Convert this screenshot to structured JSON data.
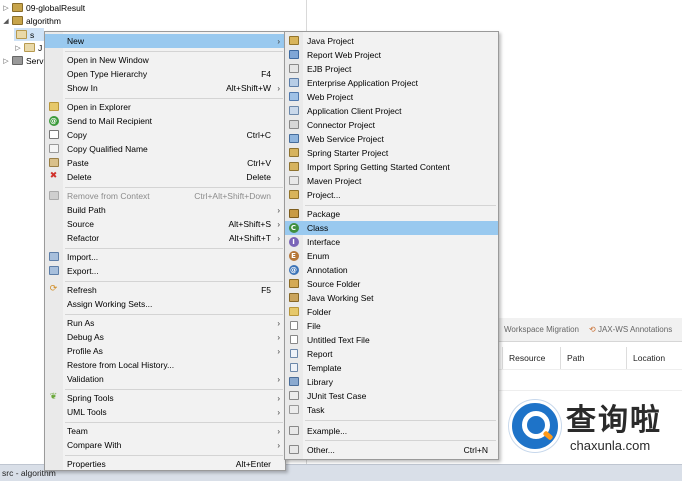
{
  "tree": {
    "items": [
      {
        "label": "09-globalResult"
      },
      {
        "label": "algorithm"
      },
      {
        "label": "s"
      },
      {
        "label": "J"
      },
      {
        "label": "Serv"
      }
    ]
  },
  "views": {
    "tabs": [
      "Workspace Migration",
      "JAX-WS Annotations"
    ],
    "columns": [
      "Resource",
      "Path",
      "Location"
    ]
  },
  "status_bar": {
    "text": "src - algorithm"
  },
  "context_menu": {
    "items": [
      {
        "label": "New",
        "accel": ""
      },
      {
        "label": "Open in New Window",
        "accel": ""
      },
      {
        "label": "Open Type Hierarchy",
        "accel": "F4"
      },
      {
        "label": "Show In",
        "accel": "Alt+Shift+W"
      },
      {
        "label": "Open in Explorer",
        "accel": ""
      },
      {
        "label": "Send to Mail Recipient",
        "accel": ""
      },
      {
        "label": "Copy",
        "accel": "Ctrl+C"
      },
      {
        "label": "Copy Qualified Name",
        "accel": ""
      },
      {
        "label": "Paste",
        "accel": "Ctrl+V"
      },
      {
        "label": "Delete",
        "accel": "Delete"
      },
      {
        "label": "Remove from Context",
        "accel": "Ctrl+Alt+Shift+Down"
      },
      {
        "label": "Build Path",
        "accel": ""
      },
      {
        "label": "Source",
        "accel": "Alt+Shift+S"
      },
      {
        "label": "Refactor",
        "accel": "Alt+Shift+T"
      },
      {
        "label": "Import...",
        "accel": ""
      },
      {
        "label": "Export...",
        "accel": ""
      },
      {
        "label": "Refresh",
        "accel": "F5"
      },
      {
        "label": "Assign Working Sets...",
        "accel": ""
      },
      {
        "label": "Run As",
        "accel": ""
      },
      {
        "label": "Debug As",
        "accel": ""
      },
      {
        "label": "Profile As",
        "accel": ""
      },
      {
        "label": "Restore from Local History...",
        "accel": ""
      },
      {
        "label": "Validation",
        "accel": ""
      },
      {
        "label": "Spring Tools",
        "accel": ""
      },
      {
        "label": "UML Tools",
        "accel": ""
      },
      {
        "label": "Team",
        "accel": ""
      },
      {
        "label": "Compare With",
        "accel": ""
      },
      {
        "label": "Properties",
        "accel": "Alt+Enter"
      }
    ]
  },
  "submenu": {
    "items": [
      {
        "label": "Java Project"
      },
      {
        "label": "Report Web Project"
      },
      {
        "label": "EJB Project"
      },
      {
        "label": "Enterprise Application Project"
      },
      {
        "label": "Web Project"
      },
      {
        "label": "Application Client Project"
      },
      {
        "label": "Connector Project"
      },
      {
        "label": "Web Service Project"
      },
      {
        "label": "Spring Starter Project"
      },
      {
        "label": "Import Spring Getting Started Content"
      },
      {
        "label": "Maven Project"
      },
      {
        "label": "Project..."
      },
      {
        "label": "Package"
      },
      {
        "label": "Class"
      },
      {
        "label": "Interface"
      },
      {
        "label": "Enum"
      },
      {
        "label": "Annotation"
      },
      {
        "label": "Source Folder"
      },
      {
        "label": "Java Working Set"
      },
      {
        "label": "Folder"
      },
      {
        "label": "File"
      },
      {
        "label": "Untitled Text File"
      },
      {
        "label": "Report"
      },
      {
        "label": "Template"
      },
      {
        "label": "Library"
      },
      {
        "label": "JUnit Test Case"
      },
      {
        "label": "Task"
      },
      {
        "label": "Example..."
      },
      {
        "label": "Other...",
        "accel": "Ctrl+N"
      }
    ]
  },
  "watermark": {
    "chinese": "查询啦",
    "domain": "chaxunla.com"
  },
  "colors": {
    "highlight": "#99c9ef",
    "menu_bg": "#f2f2f2",
    "status_bg": "#d9dfe8"
  }
}
